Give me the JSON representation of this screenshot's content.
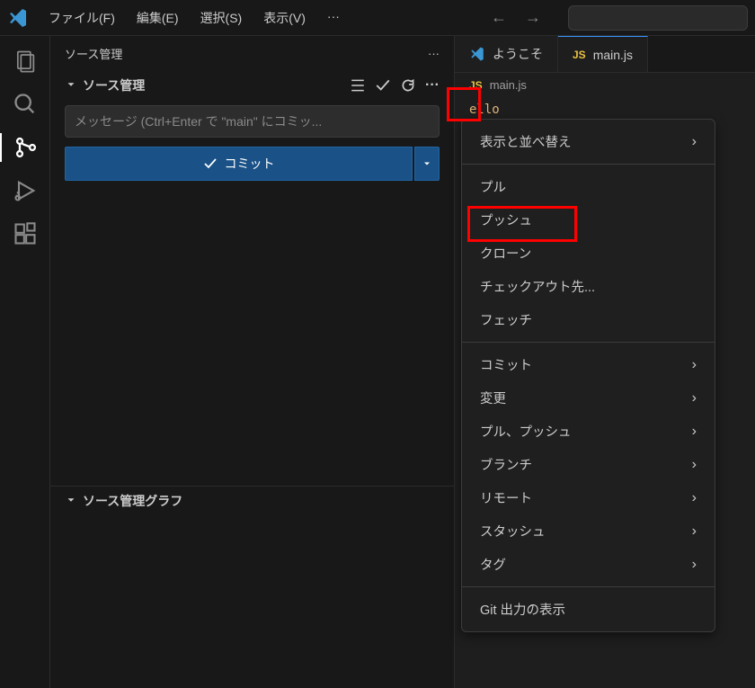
{
  "menubar": {
    "file": "ファイル(F)",
    "edit": "編集(E)",
    "select": "選択(S)",
    "view": "表示(V)",
    "more": "···"
  },
  "sidebar": {
    "title": "ソース管理",
    "section_title": "ソース管理",
    "graph_title": "ソース管理グラフ",
    "commit_placeholder": "メッセージ (Ctrl+Enter で \"main\" にコミッ...",
    "commit_button": "コミット"
  },
  "tabs": {
    "welcome": "ようこそ",
    "mainjs": "main.js"
  },
  "breadcrumb": {
    "file": "main.js"
  },
  "editor": {
    "snippet": "ello"
  },
  "context_menu": {
    "view_sort": "表示と並べ替え",
    "pull": "プル",
    "push": "プッシュ",
    "clone": "クローン",
    "checkout": "チェックアウト先...",
    "fetch": "フェッチ",
    "commit": "コミット",
    "changes": "変更",
    "pull_push": "プル、プッシュ",
    "branch": "ブランチ",
    "remote": "リモート",
    "stash": "スタッシュ",
    "tag": "タグ",
    "git_output": "Git 出力の表示"
  }
}
